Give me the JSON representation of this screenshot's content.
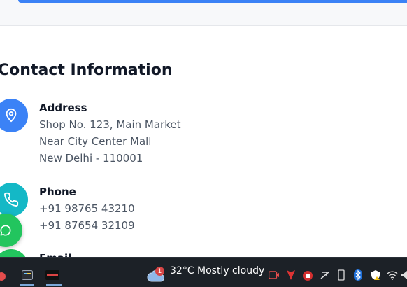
{
  "section": {
    "title": "Contact Information"
  },
  "contact": {
    "address": {
      "label": "Address",
      "lines": [
        "Shop No. 123, Main Market",
        "Near City Center Mall",
        "New Delhi - 110001"
      ]
    },
    "phone": {
      "label": "Phone",
      "lines": [
        "+91 98765 43210",
        "+91 87654 32109"
      ]
    },
    "email": {
      "label": "Email"
    }
  },
  "taskbar": {
    "weather": {
      "badge": "1",
      "temp": "32°C",
      "condition": "Mostly cloudy",
      "icon": "cloud-icon"
    },
    "tray_icons": [
      "camera-icon",
      "shield-icon",
      "red-app-icon",
      "network-icon",
      "usb-icon",
      "bluetooth-icon",
      "security-warning-icon",
      "wifi-icon"
    ]
  },
  "colors": {
    "accent": "#3b82f6",
    "phone": "#14b8c6",
    "green": "#22c55e",
    "taskbar": "#1c2127"
  }
}
